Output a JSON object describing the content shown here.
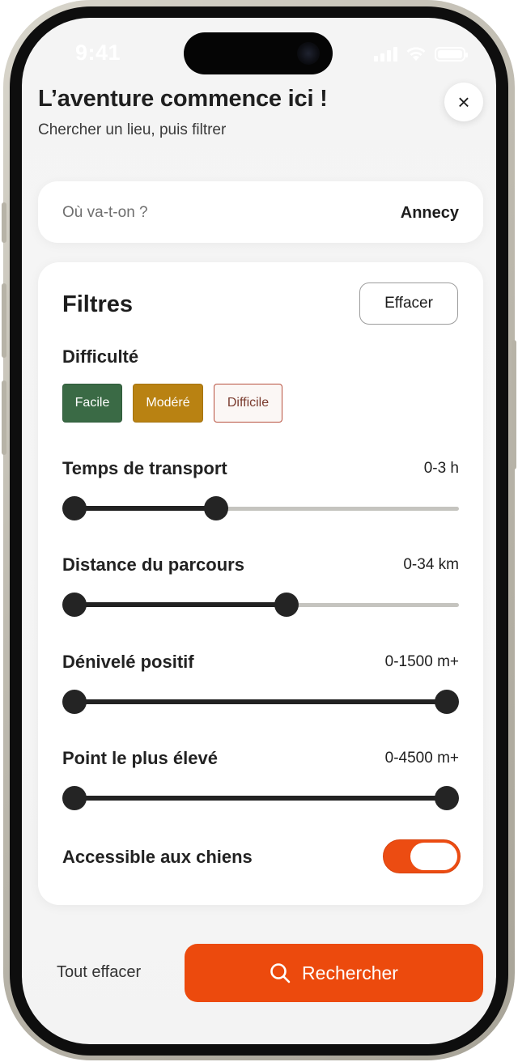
{
  "status_bar": {
    "time": "9:41"
  },
  "header": {
    "title": "L’aventure commence ici !",
    "subtitle": "Chercher un lieu, puis filtrer",
    "close_icon": "×"
  },
  "location": {
    "question": "Où va-t-on ?",
    "value": "Annecy"
  },
  "filters": {
    "title": "Filtres",
    "clear_label": "Effacer",
    "difficulty": {
      "label": "Difficulté",
      "options": [
        "Facile",
        "Modéré",
        "Difficile"
      ],
      "colors": {
        "easy": "#3a6a45",
        "moderate": "#b98212",
        "hard": "#b8513f"
      }
    },
    "transport_time": {
      "label": "Temps de transport",
      "value": "0-3 h",
      "fill": 0.38
    },
    "trail_distance": {
      "label": "Distance du parcours",
      "value": "0-34 km",
      "fill": 0.57
    },
    "elevation_gain": {
      "label": "Dénivelé positif",
      "value": "0-1500 m+",
      "fill": 1.0
    },
    "highest_point": {
      "label": "Point le plus élevé",
      "value": "0-4500 m+",
      "fill": 1.0
    },
    "dogs": {
      "label": "Accessible aux chiens",
      "enabled": true
    }
  },
  "footer": {
    "reset_all_label": "Tout effacer",
    "search_label": "Rechercher",
    "search_icon": "search-icon"
  },
  "colors": {
    "accent": "#ec4a0d",
    "text": "#1d1d1d"
  }
}
